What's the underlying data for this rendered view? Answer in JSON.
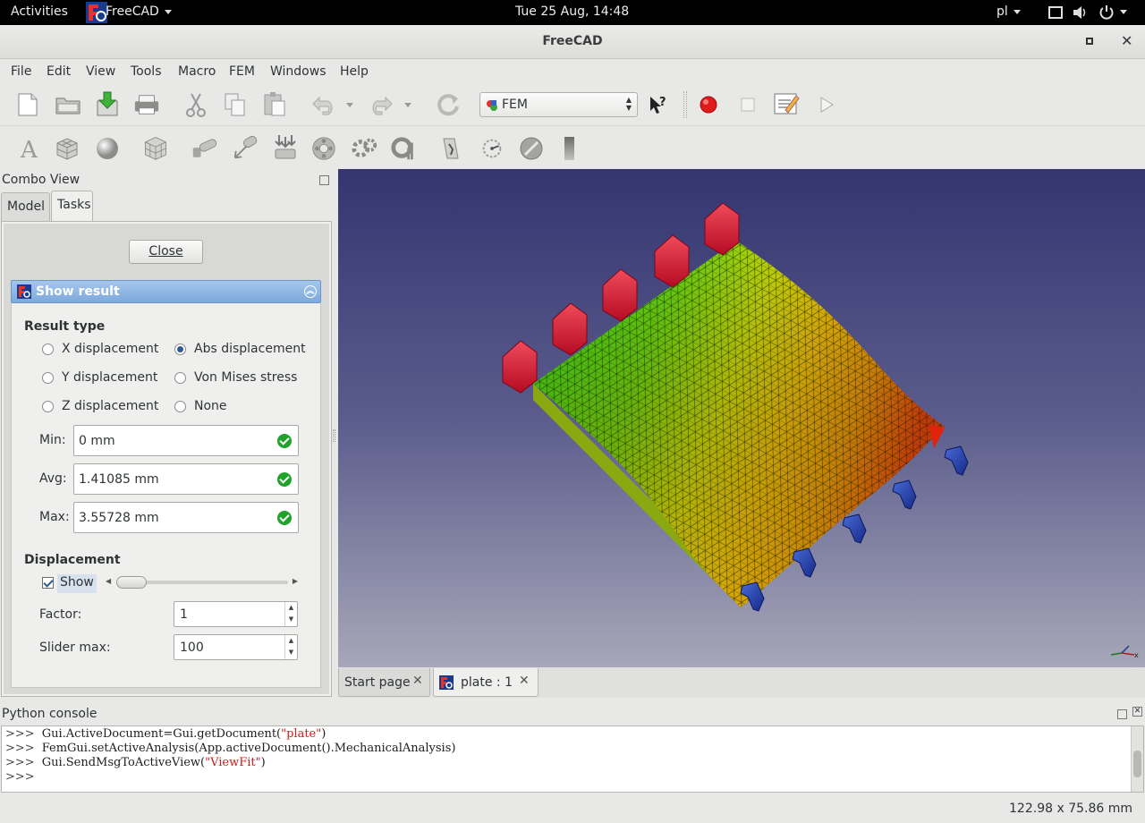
{
  "system_bar": {
    "activities": "Activities",
    "app_name": "FreeCAD",
    "clock": "Tue 25 Aug, 14:48",
    "language": "pl"
  },
  "window": {
    "title": "FreeCAD"
  },
  "menu": [
    "File",
    "Edit",
    "View",
    "Tools",
    "Macro",
    "FEM",
    "Windows",
    "Help"
  ],
  "workbench": {
    "selected": "FEM"
  },
  "combo_view": {
    "title": "Combo View",
    "tabs": [
      "Model",
      "Tasks"
    ],
    "active_tab": "Tasks",
    "close_label": "Close"
  },
  "show_result": {
    "title": "Show result",
    "result_type_label": "Result type",
    "options": [
      {
        "label": "X displacement",
        "checked": false
      },
      {
        "label": "Abs displacement",
        "checked": true
      },
      {
        "label": "Y displacement",
        "checked": false
      },
      {
        "label": "Von Mises stress",
        "checked": false
      },
      {
        "label": "Z displacement",
        "checked": false
      },
      {
        "label": "None",
        "checked": false
      }
    ],
    "min_label": "Min:",
    "min_value": "0 mm",
    "avg_label": "Avg:",
    "avg_value": "1.41085 mm",
    "max_label": "Max:",
    "max_value": "3.55728 mm",
    "displacement_label": "Displacement",
    "show_label": "Show",
    "show_checked": true,
    "slider_value": 0,
    "factor_label": "Factor:",
    "factor_value": "1",
    "slider_max_label": "Slider max:",
    "slider_max_value": "100"
  },
  "doc_tabs": [
    {
      "label": "Start page",
      "active": false
    },
    {
      "label": "plate : 1",
      "active": true
    }
  ],
  "python_console": {
    "title": "Python console",
    "lines": [
      {
        "prompt": ">>>",
        "code": "Gui.ActiveDocument=Gui.getDocument(",
        "str": "\"plate\"",
        "tail": ")"
      },
      {
        "prompt": ">>>",
        "code": "FemGui.setActiveAnalysis(App.activeDocument().MechanicalAnalysis)",
        "str": "",
        "tail": ""
      },
      {
        "prompt": ">>>",
        "code": "Gui.SendMsgToActiveView(",
        "str": "\"ViewFit\"",
        "tail": ")"
      },
      {
        "prompt": ">>>",
        "code": "",
        "str": "",
        "tail": ""
      }
    ]
  },
  "status_bar": {
    "dimensions": "122.98 x 75.86 mm"
  },
  "colors": {
    "accent_blue": "#7ea9dc",
    "record_red": "#e01b1b",
    "ok_green": "#1fa32a",
    "constraint_red": "#d8112f",
    "force_blue": "#1f3fa8"
  }
}
